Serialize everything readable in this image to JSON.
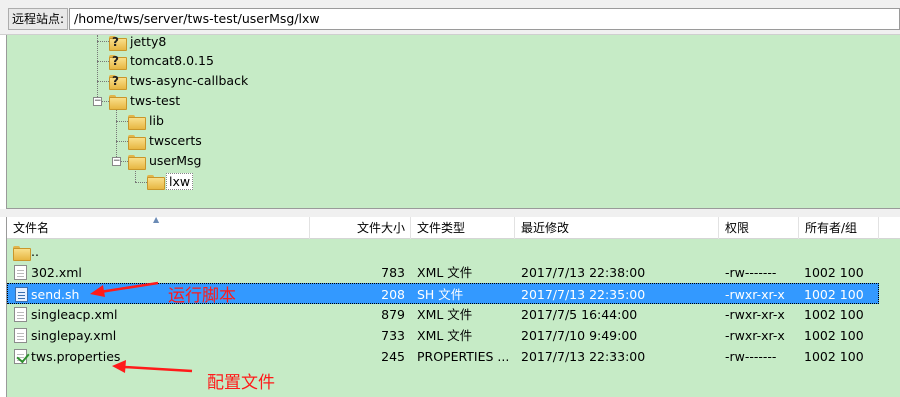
{
  "address_bar": {
    "label": "远程站点:",
    "path": "/home/tws/server/tws-test/userMsg/lxw"
  },
  "tree": {
    "nodes": [
      {
        "label": "jetty8",
        "icon": "folder-question-icon"
      },
      {
        "label": "tomcat8.0.15",
        "icon": "folder-question-icon"
      },
      {
        "label": "tws-async-callback",
        "icon": "folder-question-icon"
      },
      {
        "label": "tws-test",
        "icon": "folder-icon",
        "expanded": true
      },
      {
        "label": "lib",
        "icon": "folder-icon"
      },
      {
        "label": "twscerts",
        "icon": "folder-icon"
      },
      {
        "label": "userMsg",
        "icon": "folder-icon",
        "expanded": true
      },
      {
        "label": "lxw",
        "icon": "folder-icon",
        "selected": true
      }
    ]
  },
  "file_list": {
    "columns": [
      "文件名",
      "文件大小",
      "文件类型",
      "最近修改",
      "权限",
      "所有者/组"
    ],
    "rows": [
      {
        "name": "..",
        "size": "",
        "type": "",
        "modified": "",
        "perms": "",
        "owner": "",
        "icon": "folder-icon"
      },
      {
        "name": "302.xml",
        "size": "783",
        "type": "XML 文件",
        "modified": "2017/7/13 22:38:00",
        "perms": "-rw-------",
        "owner": "1002 100",
        "icon": "file-icon"
      },
      {
        "name": "send.sh",
        "size": "208",
        "type": "SH 文件",
        "modified": "2017/7/13 22:35:00",
        "perms": "-rwxr-xr-x",
        "owner": "1002 100",
        "icon": "script-file-icon",
        "selected": true
      },
      {
        "name": "singleacp.xml",
        "size": "879",
        "type": "XML 文件",
        "modified": "2017/7/5 16:44:00",
        "perms": "-rwxr-xr-x",
        "owner": "1002 100",
        "icon": "file-icon"
      },
      {
        "name": "singlepay.xml",
        "size": "733",
        "type": "XML 文件",
        "modified": "2017/7/10 9:49:00",
        "perms": "-rwxr-xr-x",
        "owner": "1002 100",
        "icon": "file-icon"
      },
      {
        "name": "tws.properties",
        "size": "245",
        "type": "PROPERTIES ...",
        "modified": "2017/7/13 22:33:00",
        "perms": "-rw-------",
        "owner": "1002 100",
        "icon": "properties-file-icon"
      }
    ]
  },
  "annotations": {
    "run_script": "运行脚本",
    "config_file": "配置文件",
    "color": "#ff1a1a"
  },
  "colors": {
    "panel_bg": "#c6ebc6",
    "selection": "#3399ff"
  }
}
